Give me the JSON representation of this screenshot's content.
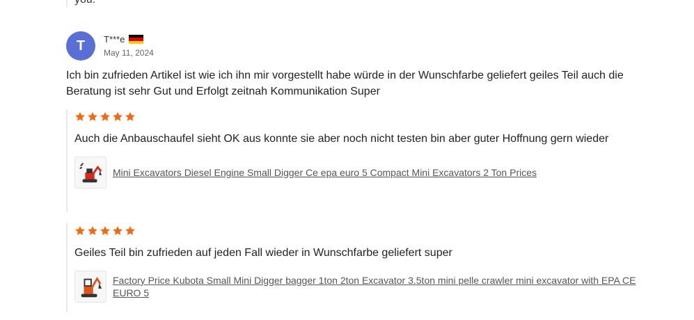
{
  "previous_review": {
    "text_tail": "you."
  },
  "review": {
    "avatar_letter": "T",
    "reviewer_name": "T***e",
    "country_flag_icon": "germany-flag-icon",
    "date": "May 11, 2024",
    "text": "Ich bin zufrieden Artikel ist wie ich ihn mir vorgestellt habe würde in der Wunschfarbe geliefert geiles Teil auch die Beratung ist sehr Gut und Erfolgt zeitnah Kommunikation Super"
  },
  "sub_reviews": [
    {
      "rating": 5,
      "text": "Auch die Anbauschaufel sieht OK aus konnte sie aber noch nicht testen bin aber guter Hoffnung gern wieder",
      "product_title": "Mini Excavators Diesel Engine Small Digger Ce epa euro 5 Compact Mini Excavators 2 Ton Prices"
    },
    {
      "rating": 5,
      "text": "Geiles Teil bin zufrieden auf jeden Fall wieder in Wunschfarbe geliefert super",
      "product_title": "Factory Price Kubota Small Mini Digger bagger 1ton 2ton Excavator 3.5ton mini pelle crawler mini excavator with EPA CE EURO 5"
    }
  ],
  "colors": {
    "avatar_bg": "#5a6fd6",
    "star": "#ef6a12",
    "link": "#555555",
    "divider": "#e8e8e8"
  }
}
